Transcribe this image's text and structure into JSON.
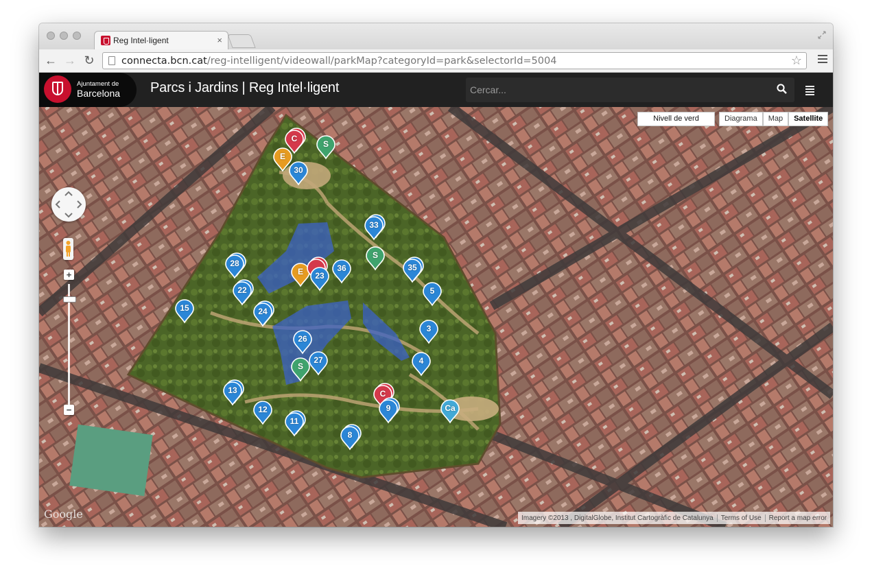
{
  "browser": {
    "tab_title": "Reg Intel·ligent",
    "tab_close": "×",
    "url_host": "connecta.bcn.cat",
    "url_path": "/reg-intelligent/videowall/parkMap?categoryId=park&selectorId=5004",
    "back": "←",
    "forward": "→",
    "reload": "↻",
    "star": "☆"
  },
  "app": {
    "logo_line1": "Ajuntament de",
    "logo_line2": "Barcelona",
    "title": "Parcs i Jardins | Reg Intel·ligent",
    "search_placeholder": "Cercar..."
  },
  "map": {
    "nivell_label": "Nivell de verd",
    "type_options": [
      "Diagrama",
      "Map",
      "Satellite"
    ],
    "selected_type": "Satellite",
    "zoom_in": "+",
    "zoom_out": "−",
    "google_label": "Google",
    "attribution": "Imagery ©2013 , DigitalGlobe, Institut Cartogràfic de Catalunya",
    "terms": "Terms of Use",
    "report": "Report a map error"
  },
  "colors": {
    "sector": "#2b86d6",
    "sensor": "#3fa36d",
    "station": "#e69b21",
    "meter": "#d4394b",
    "tank": "#43a9d6"
  },
  "markers": [
    {
      "label": "C",
      "kind": "meter",
      "stack": true
    },
    {
      "label": "E",
      "kind": "station"
    },
    {
      "label": "S",
      "kind": "sensor"
    },
    {
      "label": "30",
      "kind": "sector"
    },
    {
      "label": "33",
      "kind": "sector",
      "stack": true
    },
    {
      "label": "S",
      "kind": "sensor"
    },
    {
      "label": "28",
      "kind": "sector",
      "stack": true
    },
    {
      "label": "36",
      "kind": "sector"
    },
    {
      "label": "E",
      "kind": "station"
    },
    {
      "label": "",
      "kind": "meter",
      "stack": true
    },
    {
      "label": "23",
      "kind": "sector"
    },
    {
      "label": "35",
      "kind": "sector",
      "stack": true
    },
    {
      "label": "22",
      "kind": "sector",
      "stack": true
    },
    {
      "label": "5",
      "kind": "sector"
    },
    {
      "label": "15",
      "kind": "sector"
    },
    {
      "label": "24",
      "kind": "sector",
      "stack": true
    },
    {
      "label": "3",
      "kind": "sector"
    },
    {
      "label": "26",
      "kind": "sector"
    },
    {
      "label": "4",
      "kind": "sector"
    },
    {
      "label": "27",
      "kind": "sector"
    },
    {
      "label": "S",
      "kind": "sensor"
    },
    {
      "label": "13",
      "kind": "sector",
      "stack": true
    },
    {
      "label": "C",
      "kind": "meter",
      "stack": true
    },
    {
      "label": "9",
      "kind": "sector",
      "stack": true
    },
    {
      "label": "Ca",
      "kind": "tank"
    },
    {
      "label": "12",
      "kind": "sector"
    },
    {
      "label": "11",
      "kind": "sector",
      "stack": true
    },
    {
      "label": "8",
      "kind": "sector",
      "stack": true
    }
  ]
}
